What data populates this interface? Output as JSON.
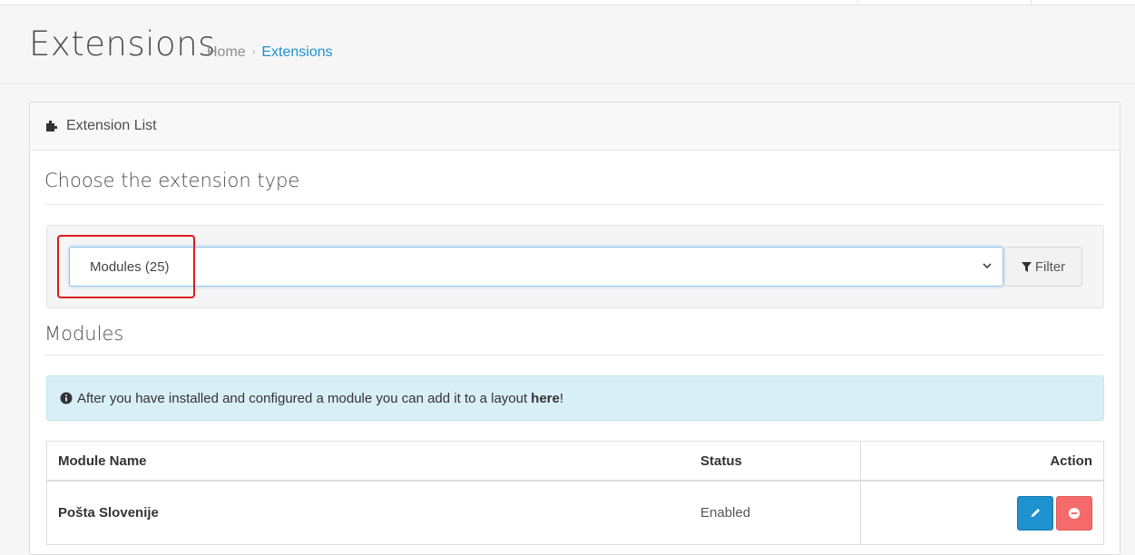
{
  "header": {
    "title": "Extensions",
    "breadcrumb": [
      {
        "label": "Home"
      },
      {
        "label": "Extensions"
      }
    ]
  },
  "panel": {
    "heading": "Extension List",
    "heading_icon": "puzzle-icon"
  },
  "choose": {
    "title": "Choose the extension type",
    "selected": "Modules (25)",
    "filter_label": "Filter",
    "filter_icon": "filter-icon"
  },
  "modules": {
    "title": "Modules",
    "alert": {
      "icon": "info-circle-icon",
      "text": "After you have installed and configured a module you can add it to a layout",
      "link": "here",
      "suffix": "!"
    },
    "table": {
      "headers": {
        "name": "Module Name",
        "status": "Status",
        "action": "Action"
      },
      "rows": [
        {
          "name": "Pošta Slovenije",
          "status": "Enabled",
          "actions": [
            "pencil-icon",
            "minus-circle-icon"
          ]
        }
      ]
    }
  },
  "colors": {
    "accent": "#1e91cf",
    "danger": "#f56b6b",
    "highlight": "#e0191f",
    "alert_bg": "#d9eff8"
  }
}
